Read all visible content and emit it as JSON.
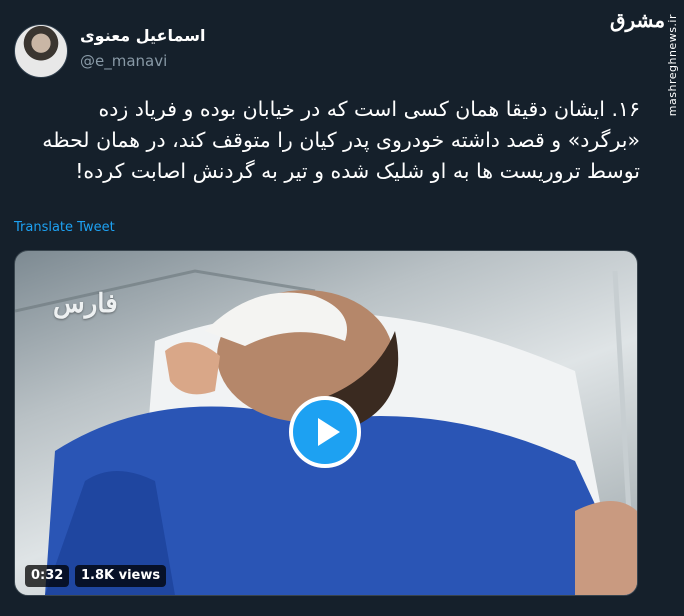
{
  "author": {
    "name": "اسماعیل معنوی",
    "handle": "@e_manavi"
  },
  "watermark": {
    "logo": "مشرق",
    "url": "mashreghnews.ir"
  },
  "tweet": {
    "text": "۱۶. ایشان دقیقا همان کسی است که در خیابان بوده و فریاد زده «برگرد» و قصد داشته خودروی پدر کیان را متوقف کند، در همان لحظه توسط تروریست ها به او شلیک شده و تیر به گردنش اصابت کرده!",
    "translate_label": "Translate Tweet"
  },
  "media": {
    "overlay_logo": "فارس",
    "duration": "0:32",
    "views": "1.8K views"
  },
  "colors": {
    "background": "#15202b",
    "accent": "#1da1f2",
    "muted": "#8899a6"
  }
}
